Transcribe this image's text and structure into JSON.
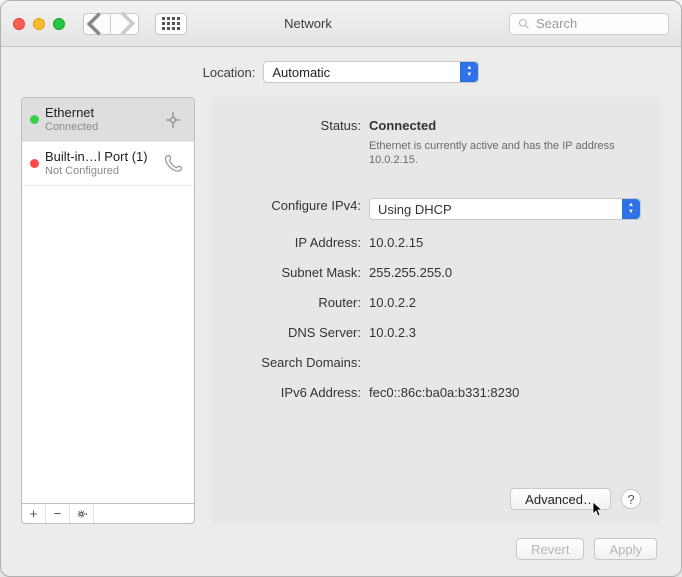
{
  "titlebar": {
    "title": "Network",
    "search_placeholder": "Search"
  },
  "location": {
    "label": "Location:",
    "value": "Automatic"
  },
  "services": [
    {
      "name": "Ethernet",
      "status": "Connected",
      "dot": "green",
      "icon": "ethernet",
      "selected": true
    },
    {
      "name": "Built-in…l Port (1)",
      "status": "Not Configured",
      "dot": "red",
      "icon": "phone",
      "selected": false
    }
  ],
  "detail": {
    "status_label": "Status:",
    "status_value": "Connected",
    "status_desc": "Ethernet is currently active and has the IP address 10.0.2.15.",
    "ipv4_label": "Configure IPv4:",
    "ipv4_value": "Using DHCP",
    "ipaddr_label": "IP Address:",
    "ipaddr_value": "10.0.2.15",
    "subnet_label": "Subnet Mask:",
    "subnet_value": "255.255.255.0",
    "router_label": "Router:",
    "router_value": "10.0.2.2",
    "dns_label": "DNS Server:",
    "dns_value": "10.0.2.3",
    "search_label": "Search Domains:",
    "search_value": "",
    "ipv6_label": "IPv6 Address:",
    "ipv6_value": "fec0::86c:ba0a:b331:8230",
    "advanced_label": "Advanced…"
  },
  "footer": {
    "revert": "Revert",
    "apply": "Apply"
  }
}
